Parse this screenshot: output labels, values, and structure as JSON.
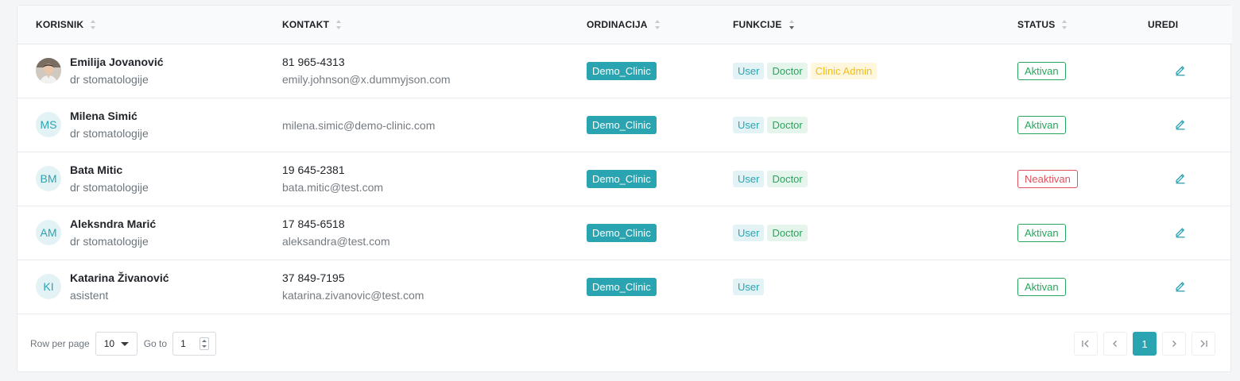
{
  "table": {
    "headers": {
      "user": "KORISNIK",
      "contact": "KONTAKT",
      "clinic": "ORDINACIJA",
      "roles": "FUNKCIJE",
      "status": "STATUS",
      "edit": "UREDI"
    },
    "rows": [
      {
        "initials": "",
        "has_photo": true,
        "name": "Emilija Jovanović",
        "title": "dr stomatologije",
        "phone": "81 965-4313",
        "email": "emily.johnson@x.dummyjson.com",
        "clinic": "Demo_Clinic",
        "roles": [
          "User",
          "Doctor",
          "Clinic Admin"
        ],
        "status": "Aktivan"
      },
      {
        "initials": "MS",
        "has_photo": false,
        "name": "Milena Simić",
        "title": "dr stomatologije",
        "phone": "",
        "email": "milena.simic@demo-clinic.com",
        "clinic": "Demo_Clinic",
        "roles": [
          "User",
          "Doctor"
        ],
        "status": "Aktivan"
      },
      {
        "initials": "BM",
        "has_photo": false,
        "name": "Bata Mitic",
        "title": "dr stomatologije",
        "phone": "19 645-2381",
        "email": "bata.mitic@test.com",
        "clinic": "Demo_Clinic",
        "roles": [
          "User",
          "Doctor"
        ],
        "status": "Neaktivan"
      },
      {
        "initials": "AM",
        "has_photo": false,
        "name": "Aleksndra Marić",
        "title": "dr stomatologije",
        "phone": "17 845-6518",
        "email": "aleksandra@test.com",
        "clinic": "Demo_Clinic",
        "roles": [
          "User",
          "Doctor"
        ],
        "status": "Aktivan"
      },
      {
        "initials": "KI",
        "has_photo": false,
        "name": "Katarina Živanović",
        "title": "asistent",
        "phone": "37 849-7195",
        "email": "katarina.zivanovic@test.com",
        "clinic": "Demo_Clinic",
        "roles": [
          "User"
        ],
        "status": "Aktivan"
      }
    ]
  },
  "footer": {
    "rows_per_page_label": "Row per page",
    "rows_per_page_value": "10",
    "goto_label": "Go to",
    "goto_value": "1",
    "current_page": "1"
  },
  "colors": {
    "accent": "#2ba4b1",
    "active": "#27a55d",
    "inactive": "#e0505b",
    "admin": "#f0bd1e"
  }
}
